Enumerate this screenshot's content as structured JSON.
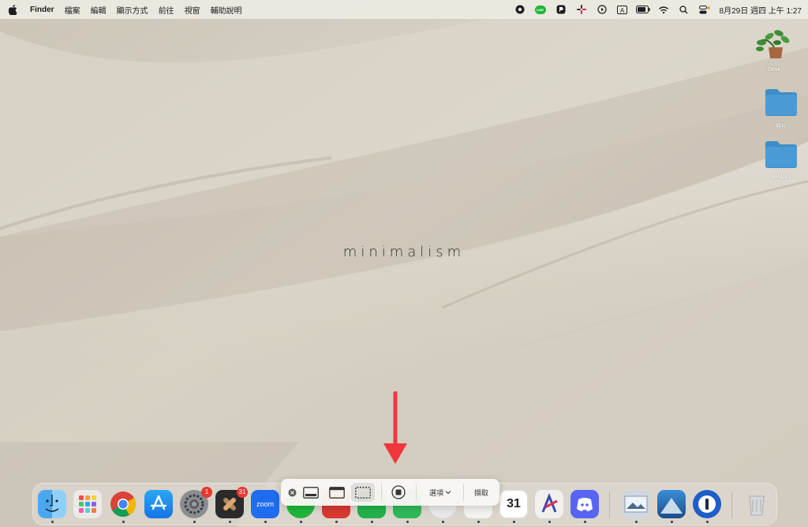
{
  "menubar": {
    "app_name": "Finder",
    "menus": [
      "檔案",
      "編輯",
      "顯示方式",
      "前往",
      "視窗",
      "輔助說明"
    ],
    "clock": "8月29日 週四 上午 1:27",
    "status_icons": [
      "record-icon",
      "line-icon",
      "p-icon",
      "slack-icon",
      "play-icon",
      "input-a-icon",
      "battery-icon",
      "wifi-icon",
      "search-icon",
      "control-center-icon"
    ],
    "input_label": "A",
    "line_label": "LINE"
  },
  "desktop": {
    "items": [
      {
        "name": "plant-image",
        "label": "Desk"
      },
      {
        "name": "folder-photos",
        "label": "照片"
      },
      {
        "name": "folder-brand",
        "label": "BRAND"
      }
    ],
    "wallpaper_text": "minimalism"
  },
  "dock": {
    "apps": [
      {
        "name": "finder",
        "badge": ""
      },
      {
        "name": "launchpad",
        "badge": ""
      },
      {
        "name": "chrome",
        "badge": ""
      },
      {
        "name": "app-store",
        "badge": ""
      },
      {
        "name": "system-settings",
        "badge": "1"
      },
      {
        "name": "slack",
        "badge": "31"
      },
      {
        "name": "zoom",
        "badge": "",
        "label": "zoom"
      },
      {
        "name": "calendar",
        "badge": "",
        "label": "31"
      },
      {
        "name": "discord",
        "badge": ""
      }
    ]
  },
  "screenshot_toolbar": {
    "options_label": "選項",
    "capture_label": "擷取"
  },
  "colors": {
    "accent_red": "#f0373c",
    "folder_blue": "#4a9ad4",
    "badge_red": "#e8372f"
  }
}
